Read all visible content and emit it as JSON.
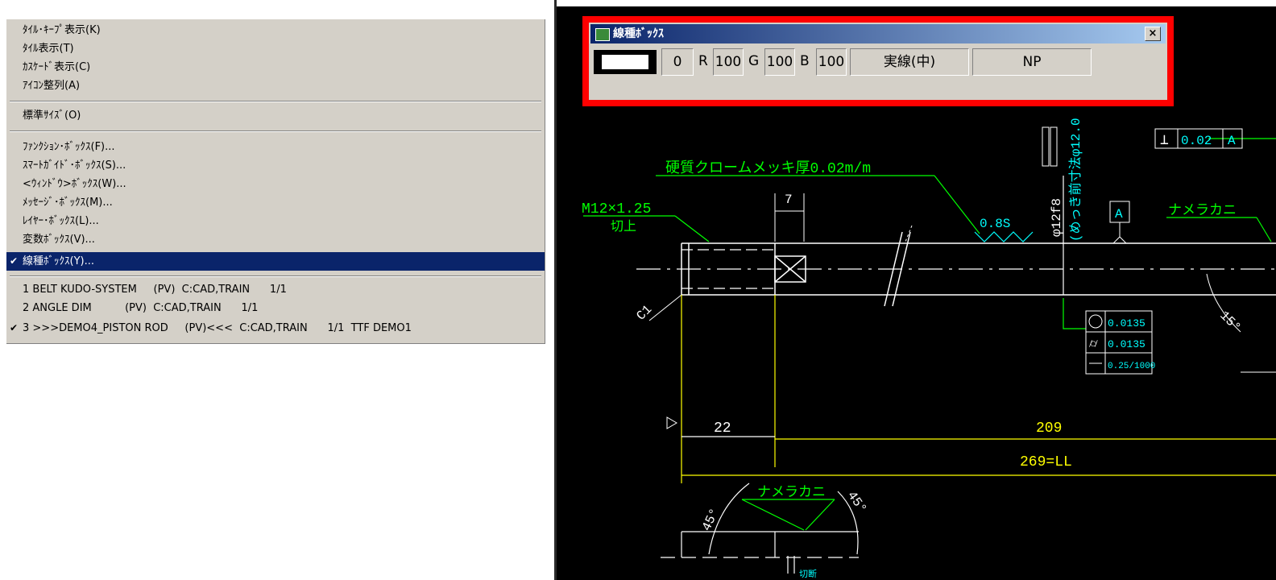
{
  "window_menu": {
    "group1": [
      "ﾀｲﾙ･ｷｰﾌﾟ表示(K)",
      "ﾀｲﾙ表示(T)",
      "ｶｽｹｰﾄﾞ表示(C)",
      "ｱｲｺﾝ整列(A)"
    ],
    "standard_size": "標準ｻｲｽﾞ(O)",
    "group2": [
      "ﾌｧﾝｸｼｮﾝ･ﾎﾞｯｸｽ(F)...",
      "ｽﾏｰﾄｶﾞｲﾄﾞ･ﾎﾞｯｸｽ(S)...",
      "<ｳｨﾝﾄﾞｳ>ﾎﾞｯｸｽ(W)...",
      "ﾒｯｾｰｼﾞ･ﾎﾞｯｸｽ(M)...",
      "ﾚｲﾔｰ･ﾎﾞｯｸｽ(L)...",
      "変数ﾎﾞｯｸｽ(V)..."
    ],
    "selected": "線種ﾎﾞｯｸｽ(Y)...",
    "check_glyph": "✔",
    "windows": [
      "1 BELT KUDO-SYSTEM     (PV)  C:CAD,TRAIN      1/1",
      "2 ANGLE DIM          (PV)  C:CAD,TRAIN      1/1",
      "3 >>>DEMO4_PISTON ROD     (PV)<<<  C:CAD,TRAIN      1/1  TTF DEMO1"
    ]
  },
  "linetype_box": {
    "title": "線種ﾎﾞｯｸｽ",
    "close": "×",
    "color_index": "0",
    "r_label": "R",
    "r_value": "100",
    "g_label": "G",
    "g_value": "100",
    "b_label": "B",
    "b_value": "100",
    "line_type": "実線(中)",
    "plot": "NP"
  },
  "drawing": {
    "chrome_note": "硬質クロームメッキ厚0.02m/m",
    "thread": "M12×1.25",
    "cut": "切上",
    "roughness": "0.8S",
    "diameter": "φ12f8",
    "plating_note": "(めっき前寸法φ12.0",
    "perp_sym": "⊥",
    "perp_val": "0.02",
    "perp_ref": "A",
    "datum": "A",
    "nameraka": "ナメラカニ",
    "chamfer": "C1",
    "angle15": "15°",
    "tol_circle": "0.0135",
    "tol_cyl": "0.0135",
    "tol_straight": "0.25/1000",
    "dim22": "22",
    "dim209": "209",
    "dim269": "269=LL",
    "angle45a": "45°",
    "angle45b": "45°",
    "bottom_label": "切断"
  }
}
